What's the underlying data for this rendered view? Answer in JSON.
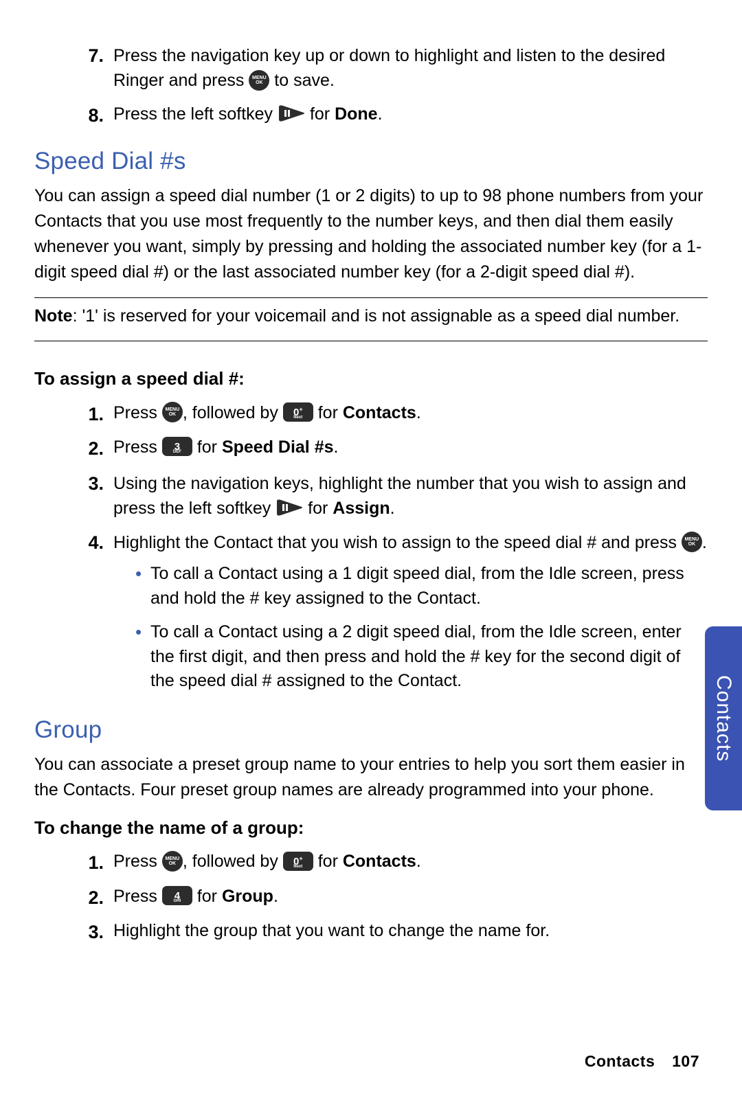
{
  "topSteps": {
    "s7": {
      "num": "7.",
      "pre": "Press the navigation key up or down to highlight and listen to the desired Ringer and press ",
      "post": " to save."
    },
    "s8": {
      "num": "8.",
      "pre": "Press the left softkey ",
      "mid": " for ",
      "bold": "Done",
      "post": "."
    }
  },
  "speedDial": {
    "heading": "Speed Dial #s",
    "intro": "You can assign a speed dial number (1 or 2 digits) to up to 98 phone numbers from your Contacts that you use most frequently to the number keys, and then dial them easily whenever you want, simply by pressing and holding the associated number key (for a 1-digit speed dial #) or the last associated number key (for a 2-digit speed dial #).",
    "noteLabel": "Note",
    "noteText": ": '1' is reserved for your voicemail and is not assignable as a speed dial number.",
    "subhead": "To assign a speed dial #:",
    "steps": {
      "s1": {
        "num": "1.",
        "a": "Press ",
        "b": ", followed by ",
        "c": " for ",
        "bold": "Contacts",
        "d": "."
      },
      "s2": {
        "num": "2.",
        "a": "Press ",
        "b": " for ",
        "bold": "Speed Dial #s",
        "c": "."
      },
      "s3": {
        "num": "3.",
        "a": "Using the navigation keys, highlight the number that you wish to assign and press the left softkey ",
        "b": " for ",
        "bold": "Assign",
        "c": "."
      },
      "s4": {
        "num": "4.",
        "a": "Highlight the Contact that you wish to assign to the speed dial # and press ",
        "b": "."
      }
    },
    "bullets": {
      "b1": "To call a Contact using a 1 digit speed dial, from the Idle screen, press and hold the # key assigned to the Contact.",
      "b2": "To call a Contact using a 2 digit speed dial, from the Idle screen, enter the first digit, and then press and hold the # key for the second digit of the speed dial # assigned to the Contact."
    }
  },
  "group": {
    "heading": "Group",
    "intro": "You can associate a preset group name to your entries to help you sort them easier in the Contacts. Four preset group names are already programmed into your phone.",
    "subhead": "To change the name of a group:",
    "steps": {
      "s1": {
        "num": "1.",
        "a": "Press ",
        "b": ", followed by ",
        "c": " for ",
        "bold": "Contacts",
        "d": "."
      },
      "s2": {
        "num": "2.",
        "a": "Press ",
        "b": " for ",
        "bold": "Group",
        "c": "."
      },
      "s3": {
        "num": "3.",
        "a": "Highlight the group that you want to change the name for."
      }
    }
  },
  "keys": {
    "zero": {
      "main": "0",
      "sup": "+"
    },
    "three": {
      "main": "3"
    },
    "four": {
      "main": "4"
    }
  },
  "sideTab": "Contacts",
  "footer": {
    "section": "Contacts",
    "page": "107"
  }
}
